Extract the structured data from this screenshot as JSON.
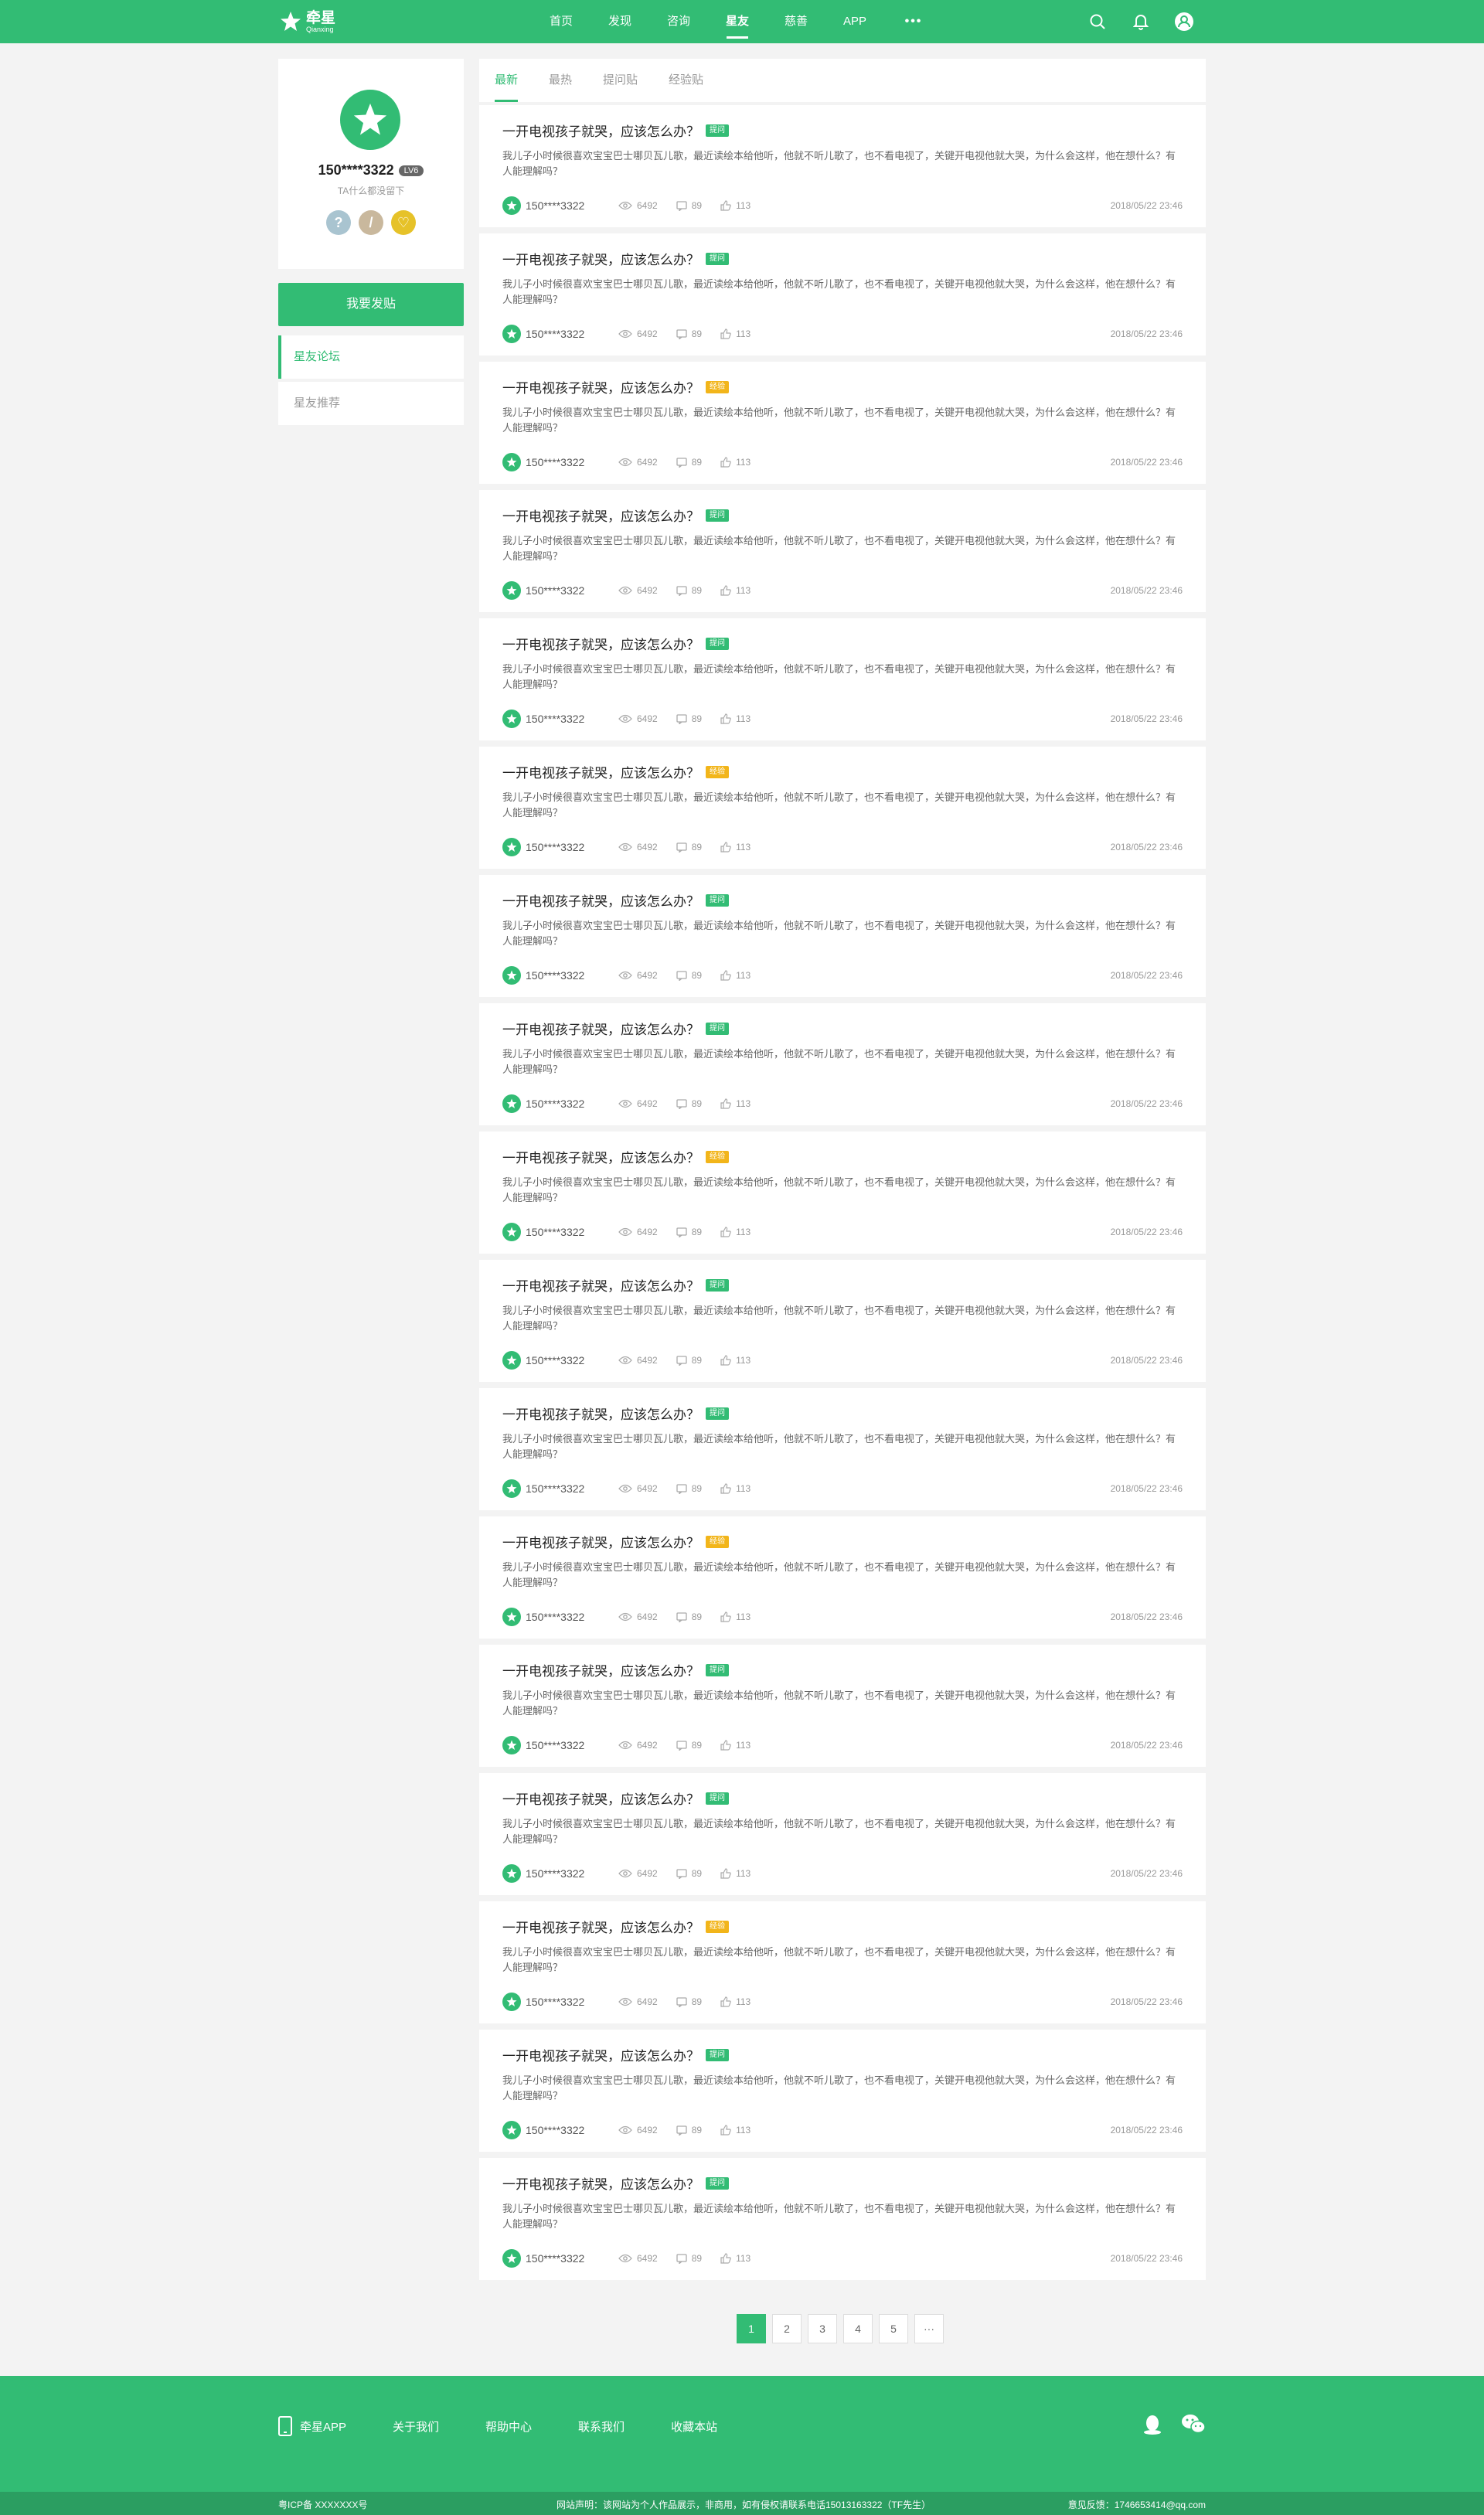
{
  "brand": {
    "name": "牵星",
    "sub": "Qianxing",
    "accent": "#32bc74"
  },
  "nav": [
    {
      "label": "首页",
      "active": false
    },
    {
      "label": "发现",
      "active": false
    },
    {
      "label": "咨询",
      "active": false
    },
    {
      "label": "星友",
      "active": true
    },
    {
      "label": "慈善",
      "active": false
    },
    {
      "label": "APP",
      "active": false
    },
    {
      "label": "•••",
      "active": false
    }
  ],
  "profile": {
    "name": "150****3322",
    "level": "LV6",
    "signature": "TA什么都没留下",
    "post_button": "我要发贴",
    "menu": [
      "星友论坛",
      "星友推荐"
    ]
  },
  "tabs": [
    "最新",
    "最热",
    "提问贴",
    "经验贴"
  ],
  "posts": [
    {
      "title": "一开电视孩子就哭，应该怎么办？",
      "tag": "提问",
      "tagColor": "green",
      "body": "我儿子小时候很喜欢宝宝巴士哪贝瓦儿歌，最近读绘本给他听，他就不听儿歌了，也不看电视了，关键开电视他就大哭，为什么会这样，他在想什么？有人能理解吗？",
      "user": "150****3322",
      "views": "6492",
      "comments": "89",
      "likes": "113",
      "date": "2018/05/22  23:46"
    },
    {
      "title": "一开电视孩子就哭，应该怎么办？",
      "tag": "提问",
      "tagColor": "green",
      "body": "我儿子小时候很喜欢宝宝巴士哪贝瓦儿歌，最近读绘本给他听，他就不听儿歌了，也不看电视了，关键开电视他就大哭，为什么会这样，他在想什么？有人能理解吗？",
      "user": "150****3322",
      "views": "6492",
      "comments": "89",
      "likes": "113",
      "date": "2018/05/22  23:46"
    },
    {
      "title": "一开电视孩子就哭，应该怎么办？",
      "tag": "经验",
      "tagColor": "yellow",
      "body": "我儿子小时候很喜欢宝宝巴士哪贝瓦儿歌，最近读绘本给他听，他就不听儿歌了，也不看电视了，关键开电视他就大哭，为什么会这样，他在想什么？有人能理解吗？",
      "user": "150****3322",
      "views": "6492",
      "comments": "89",
      "likes": "113",
      "date": "2018/05/22  23:46"
    },
    {
      "title": "一开电视孩子就哭，应该怎么办？",
      "tag": "提问",
      "tagColor": "green",
      "body": "我儿子小时候很喜欢宝宝巴士哪贝瓦儿歌，最近读绘本给他听，他就不听儿歌了，也不看电视了，关键开电视他就大哭，为什么会这样，他在想什么？有人能理解吗？",
      "user": "150****3322",
      "views": "6492",
      "comments": "89",
      "likes": "113",
      "date": "2018/05/22  23:46"
    },
    {
      "title": "一开电视孩子就哭，应该怎么办？",
      "tag": "提问",
      "tagColor": "green",
      "body": "我儿子小时候很喜欢宝宝巴士哪贝瓦儿歌，最近读绘本给他听，他就不听儿歌了，也不看电视了，关键开电视他就大哭，为什么会这样，他在想什么？有人能理解吗？",
      "user": "150****3322",
      "views": "6492",
      "comments": "89",
      "likes": "113",
      "date": "2018/05/22  23:46"
    },
    {
      "title": "一开电视孩子就哭，应该怎么办？",
      "tag": "经验",
      "tagColor": "yellow",
      "body": "我儿子小时候很喜欢宝宝巴士哪贝瓦儿歌，最近读绘本给他听，他就不听儿歌了，也不看电视了，关键开电视他就大哭，为什么会这样，他在想什么？有人能理解吗？",
      "user": "150****3322",
      "views": "6492",
      "comments": "89",
      "likes": "113",
      "date": "2018/05/22  23:46"
    },
    {
      "title": "一开电视孩子就哭，应该怎么办？",
      "tag": "提问",
      "tagColor": "green",
      "body": "我儿子小时候很喜欢宝宝巴士哪贝瓦儿歌，最近读绘本给他听，他就不听儿歌了，也不看电视了，关键开电视他就大哭，为什么会这样，他在想什么？有人能理解吗？",
      "user": "150****3322",
      "views": "6492",
      "comments": "89",
      "likes": "113",
      "date": "2018/05/22  23:46"
    },
    {
      "title": "一开电视孩子就哭，应该怎么办？",
      "tag": "提问",
      "tagColor": "green",
      "body": "我儿子小时候很喜欢宝宝巴士哪贝瓦儿歌，最近读绘本给他听，他就不听儿歌了，也不看电视了，关键开电视他就大哭，为什么会这样，他在想什么？有人能理解吗？",
      "user": "150****3322",
      "views": "6492",
      "comments": "89",
      "likes": "113",
      "date": "2018/05/22  23:46"
    },
    {
      "title": "一开电视孩子就哭，应该怎么办？",
      "tag": "经验",
      "tagColor": "yellow",
      "body": "我儿子小时候很喜欢宝宝巴士哪贝瓦儿歌，最近读绘本给他听，他就不听儿歌了，也不看电视了，关键开电视他就大哭，为什么会这样，他在想什么？有人能理解吗？",
      "user": "150****3322",
      "views": "6492",
      "comments": "89",
      "likes": "113",
      "date": "2018/05/22  23:46"
    },
    {
      "title": "一开电视孩子就哭，应该怎么办？",
      "tag": "提问",
      "tagColor": "green",
      "body": "我儿子小时候很喜欢宝宝巴士哪贝瓦儿歌，最近读绘本给他听，他就不听儿歌了，也不看电视了，关键开电视他就大哭，为什么会这样，他在想什么？有人能理解吗？",
      "user": "150****3322",
      "views": "6492",
      "comments": "89",
      "likes": "113",
      "date": "2018/05/22  23:46"
    },
    {
      "title": "一开电视孩子就哭，应该怎么办？",
      "tag": "提问",
      "tagColor": "green",
      "body": "我儿子小时候很喜欢宝宝巴士哪贝瓦儿歌，最近读绘本给他听，他就不听儿歌了，也不看电视了，关键开电视他就大哭，为什么会这样，他在想什么？有人能理解吗？",
      "user": "150****3322",
      "views": "6492",
      "comments": "89",
      "likes": "113",
      "date": "2018/05/22  23:46"
    },
    {
      "title": "一开电视孩子就哭，应该怎么办？",
      "tag": "经验",
      "tagColor": "yellow",
      "body": "我儿子小时候很喜欢宝宝巴士哪贝瓦儿歌，最近读绘本给他听，他就不听儿歌了，也不看电视了，关键开电视他就大哭，为什么会这样，他在想什么？有人能理解吗？",
      "user": "150****3322",
      "views": "6492",
      "comments": "89",
      "likes": "113",
      "date": "2018/05/22  23:46"
    },
    {
      "title": "一开电视孩子就哭，应该怎么办？",
      "tag": "提问",
      "tagColor": "green",
      "body": "我儿子小时候很喜欢宝宝巴士哪贝瓦儿歌，最近读绘本给他听，他就不听儿歌了，也不看电视了，关键开电视他就大哭，为什么会这样，他在想什么？有人能理解吗？",
      "user": "150****3322",
      "views": "6492",
      "comments": "89",
      "likes": "113",
      "date": "2018/05/22  23:46"
    },
    {
      "title": "一开电视孩子就哭，应该怎么办？",
      "tag": "提问",
      "tagColor": "green",
      "body": "我儿子小时候很喜欢宝宝巴士哪贝瓦儿歌，最近读绘本给他听，他就不听儿歌了，也不看电视了，关键开电视他就大哭，为什么会这样，他在想什么？有人能理解吗？",
      "user": "150****3322",
      "views": "6492",
      "comments": "89",
      "likes": "113",
      "date": "2018/05/22  23:46"
    },
    {
      "title": "一开电视孩子就哭，应该怎么办？",
      "tag": "经验",
      "tagColor": "yellow",
      "body": "我儿子小时候很喜欢宝宝巴士哪贝瓦儿歌，最近读绘本给他听，他就不听儿歌了，也不看电视了，关键开电视他就大哭，为什么会这样，他在想什么？有人能理解吗？",
      "user": "150****3322",
      "views": "6492",
      "comments": "89",
      "likes": "113",
      "date": "2018/05/22  23:46"
    },
    {
      "title": "一开电视孩子就哭，应该怎么办？",
      "tag": "提问",
      "tagColor": "green",
      "body": "我儿子小时候很喜欢宝宝巴士哪贝瓦儿歌，最近读绘本给他听，他就不听儿歌了，也不看电视了，关键开电视他就大哭，为什么会这样，他在想什么？有人能理解吗？",
      "user": "150****3322",
      "views": "6492",
      "comments": "89",
      "likes": "113",
      "date": "2018/05/22  23:46"
    },
    {
      "title": "一开电视孩子就哭，应该怎么办？",
      "tag": "提问",
      "tagColor": "green",
      "body": "我儿子小时候很喜欢宝宝巴士哪贝瓦儿歌，最近读绘本给他听，他就不听儿歌了，也不看电视了，关键开电视他就大哭，为什么会这样，他在想什么？有人能理解吗？",
      "user": "150****3322",
      "views": "6492",
      "comments": "89",
      "likes": "113",
      "date": "2018/05/22  23:46"
    }
  ],
  "pagination": [
    "1",
    "2",
    "3",
    "4",
    "5",
    "···"
  ],
  "footer": {
    "links": [
      "牵星APP",
      "关于我们",
      "帮助中心",
      "联系我们",
      "收藏本站"
    ],
    "icp": "粤ICP备 XXXXXXX号",
    "statement": "网站声明：该网站为个人作品展示，非商用，如有侵权请联系电话15013163322（TF先生）",
    "contact": "意见反馈：1746653414@qq.com"
  }
}
